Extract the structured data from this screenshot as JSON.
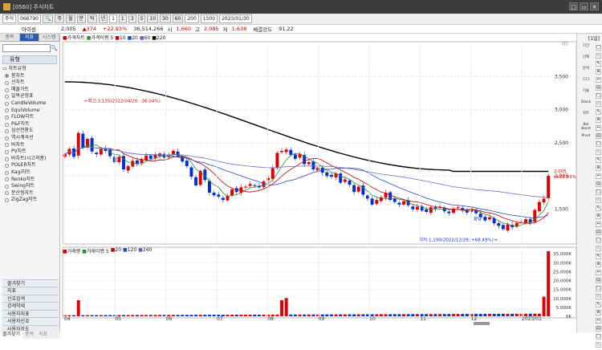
{
  "window": {
    "title": "[0560] 주식차트",
    "controls": [
      "□",
      "▭",
      "✕"
    ]
  },
  "toolbar": {
    "market": "주식",
    "code": "066790",
    "periods": [
      "주",
      "월",
      "분",
      "틱",
      "년"
    ],
    "count": "1",
    "minutes": [
      "1",
      "3",
      "5",
      "10",
      "30",
      "60"
    ],
    "bars": "200",
    "total": "1500",
    "date": "2023/01/30"
  },
  "quote": {
    "name": "아이원",
    "price": "2,005",
    "change": "▲374",
    "pct": "+22.93%",
    "volume": "36,514,266",
    "open_label": "시",
    "open": "1,660",
    "high_label": "고",
    "high": "2,085",
    "low_label": "저",
    "low": "1,638",
    "strength_label": "체결강도",
    "strength": "91.22"
  },
  "sidebar": {
    "tabs": [
      "종목",
      "지표",
      "시스템"
    ],
    "group_title": "유형",
    "parent": "차트유형",
    "items": [
      "봉차트",
      "선차트",
      "매물가트",
      "일목균형표",
      "CandleVolume",
      "EquiVolume",
      "FLOW차트",
      "P&F차트",
      "삼선전환도",
      "역시계곡선",
      "바차트",
      "PV차트",
      "바차트(시고저종)",
      "POLER차트",
      "Kagi차트",
      "Renko차트",
      "Swing차트",
      "분산형차트",
      "ZigZag차트"
    ],
    "bottom_items": [
      "즐겨찾기",
      "지표",
      "신호검색",
      "강세약세",
      "사용자지표",
      "사용자신호",
      "사용자강도"
    ],
    "bottom_tabs": [
      "즐겨찾기",
      "종목",
      "지표"
    ]
  },
  "chart_header": {
    "main": [
      "가격차트",
      "가격이평 5",
      "10",
      "20",
      "60",
      "220"
    ],
    "volume": [
      "거래량",
      "거래이평 5",
      "20",
      "120",
      "240"
    ],
    "one_day": "[1일]",
    "y_unit": "(원)"
  },
  "right_panel": {
    "buttons": [
      "기간",
      "선택",
      "분석",
      "CCI",
      "기술",
      "Stock",
      "차트",
      "Bol Band",
      "Pivot"
    ]
  },
  "chart_data": {
    "type": "candlestick",
    "series_names": [
      "가격차트",
      "가격이평 5",
      "10",
      "20",
      "60",
      "220"
    ],
    "price_ticks": [
      "3,500",
      "3,000",
      "2,500",
      "2,005",
      "1,500"
    ],
    "price_ylim": [
      1000,
      4000
    ],
    "volume_ticks": [
      "35,000K",
      "30,000K",
      "25,000K",
      "20,000K",
      "15,000K",
      "10,000K",
      "5,000K",
      "0K"
    ],
    "volume_ylim": [
      0,
      36000000
    ],
    "x_months": [
      "04",
      "05",
      "06",
      "07",
      "08",
      "09",
      "10",
      "11",
      "12",
      "2023/01"
    ],
    "annotations": {
      "high": "최고:3,135(2022/04/20, -36.04%)",
      "low": "최저:1,190(2022/12/29, +68.49%)",
      "last_price": "2,005",
      "last_pct": "(+22.93%)",
      "short_label": "봉당"
    },
    "closes": [
      2330,
      2410,
      2290,
      2650,
      2430,
      2560,
      2370,
      2330,
      2410,
      2380,
      2300,
      2210,
      2290,
      2100,
      2150,
      2230,
      2180,
      2250,
      2310,
      2260,
      2320,
      2340,
      2280,
      2310,
      2380,
      2300,
      2220,
      2150,
      1990,
      1860,
      2080,
      1940,
      1750,
      1710,
      1690,
      1640,
      1700,
      1800,
      1760,
      1830,
      1840,
      1880,
      1860,
      1830,
      1920,
      1970,
      2120,
      2350,
      2380,
      2400,
      2320,
      2260,
      2330,
      2180,
      2210,
      2100,
      2130,
      2050,
      2000,
      1990,
      2040,
      1900,
      1950,
      1870,
      1760,
      1840,
      1720,
      1660,
      1570,
      1640,
      1680,
      1750,
      1640,
      1610,
      1570,
      1620,
      1560,
      1500,
      1540,
      1480,
      1460,
      1530,
      1510,
      1540,
      1470,
      1440,
      1510,
      1530,
      1480,
      1450,
      1510,
      1440,
      1380,
      1330,
      1380,
      1290,
      1250,
      1200,
      1270,
      1230,
      1290,
      1310,
      1350,
      1300,
      1490,
      1610,
      1660,
      2005
    ],
    "volume_spike_millions": 36.5
  }
}
